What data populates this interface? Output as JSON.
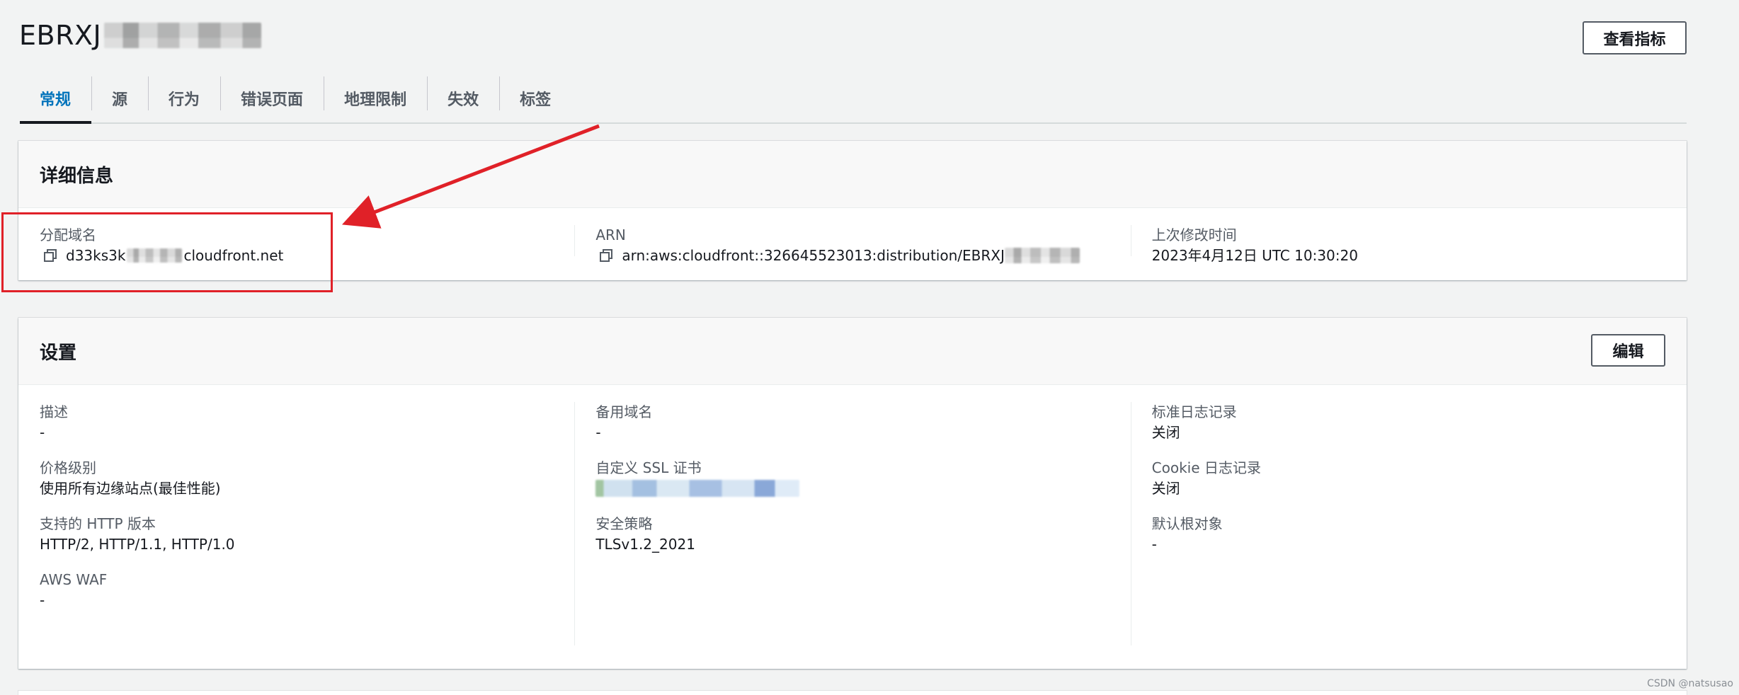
{
  "header": {
    "title_prefix": "EBRXJ",
    "metrics_button": "查看指标"
  },
  "tabs": [
    {
      "label": "常规",
      "active": true
    },
    {
      "label": "源",
      "active": false
    },
    {
      "label": "行为",
      "active": false
    },
    {
      "label": "错误页面",
      "active": false
    },
    {
      "label": "地理限制",
      "active": false
    },
    {
      "label": "失效",
      "active": false
    },
    {
      "label": "标签",
      "active": false
    }
  ],
  "details": {
    "title": "详细信息",
    "domain_label": "分配域名",
    "domain_prefix": "d33ks3k",
    "domain_suffix": "cloudfront.net",
    "arn_label": "ARN",
    "arn_value": "arn:aws:cloudfront::326645523013:distribution/EBRXJ",
    "modified_label": "上次修改时间",
    "modified_value": "2023年4月12日 UTC 10:30:20"
  },
  "settings": {
    "title": "设置",
    "edit_button": "编辑",
    "col1": {
      "description_label": "描述",
      "description_value": "-",
      "price_label": "价格级别",
      "price_value": "使用所有边缘站点(最佳性能)",
      "http_label": "支持的 HTTP 版本",
      "http_value": "HTTP/2, HTTP/1.1, HTTP/1.0",
      "waf_label": "AWS WAF",
      "waf_value": "-"
    },
    "col2": {
      "alt_domain_label": "备用域名",
      "alt_domain_value": "-",
      "ssl_label": "自定义 SSL 证书",
      "policy_label": "安全策略",
      "policy_value": "TLSv1.2_2021"
    },
    "col3": {
      "std_log_label": "标准日志记录",
      "std_log_value": "关闭",
      "cookie_log_label": "Cookie 日志记录",
      "cookie_log_value": "关闭",
      "root_label": "默认根对象",
      "root_value": "-"
    }
  },
  "watermark": "CSDN @natsusao",
  "colors": {
    "accent": "#0073bb",
    "annotation": "#e02128"
  }
}
